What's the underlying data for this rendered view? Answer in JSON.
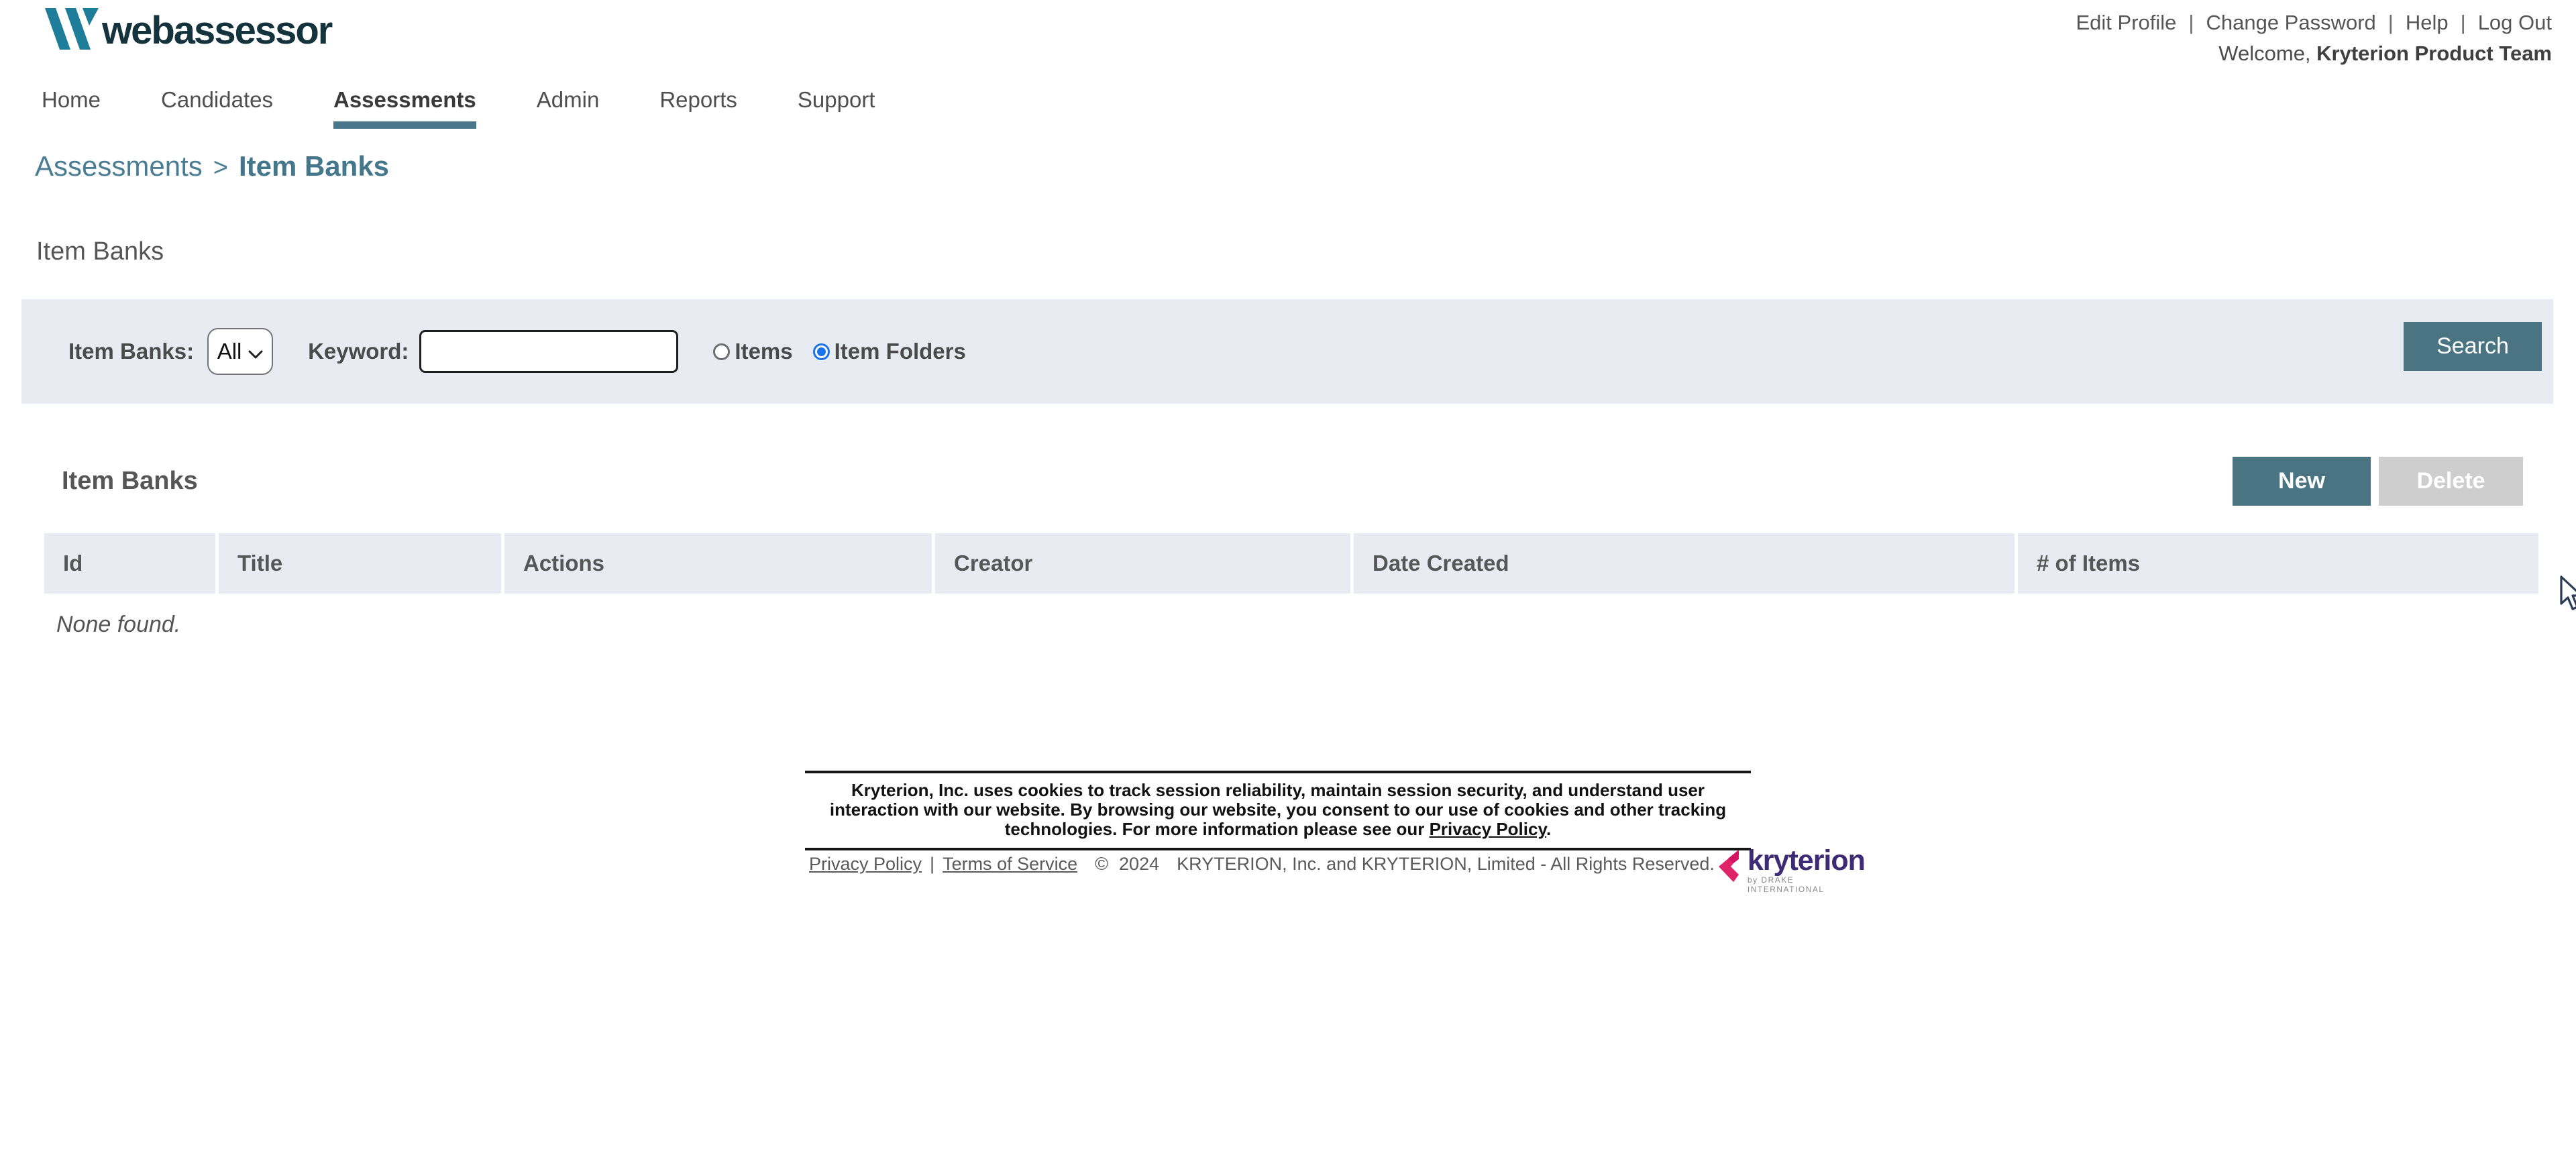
{
  "header": {
    "logo_text": "webassessor",
    "links": {
      "edit_profile": "Edit Profile",
      "change_password": "Change Password",
      "help": "Help",
      "log_out": "Log Out"
    },
    "separator": "|",
    "welcome_prefix": "Welcome,",
    "welcome_name": "Kryterion Product Team"
  },
  "nav": {
    "items": [
      {
        "label": "Home",
        "active": false
      },
      {
        "label": "Candidates",
        "active": false
      },
      {
        "label": "Assessments",
        "active": true
      },
      {
        "label": "Admin",
        "active": false
      },
      {
        "label": "Reports",
        "active": false
      },
      {
        "label": "Support",
        "active": false
      }
    ]
  },
  "breadcrumb": {
    "parent": "Assessments",
    "separator": ">",
    "current": "Item Banks"
  },
  "page": {
    "title": "Item Banks"
  },
  "search": {
    "item_banks_label": "Item Banks:",
    "item_banks_value": "All",
    "keyword_label": "Keyword:",
    "keyword_value": "",
    "radio_items_label": "Items",
    "radio_item_folders_label": "Item Folders",
    "selected_radio": "Item Folders",
    "search_button": "Search"
  },
  "list": {
    "title": "Item Banks",
    "new_button": "New",
    "delete_button": "Delete",
    "delete_enabled": false,
    "columns": [
      "Id",
      "Title",
      "Actions",
      "Creator",
      "Date Created",
      "# of Items"
    ],
    "rows": [],
    "empty_text": "None found."
  },
  "footer": {
    "cookie_text_before_link": "Kryterion, Inc. uses cookies to track session reliability, maintain session security, and understand user interaction with our website. By browsing our website, you consent to our use of cookies and other tracking technologies. For more information please see our ",
    "cookie_link": "Privacy Policy",
    "cookie_text_after_link": ".",
    "privacy_link": "Privacy Policy ",
    "terms_link": "Terms of Service ",
    "links_separator": "|",
    "copyright_symbol": "©",
    "copyright_year": "2024",
    "copyright_text": "KRYTERION, Inc. and KRYTERION, Limited - All Rights Reserved.",
    "logo_text": "kryterion",
    "logo_subtext": "by DRAKE INTERNATIONAL"
  },
  "colors": {
    "accent_teal": "#4a7482",
    "nav_underline": "#49768a",
    "breadcrumb": "#4a7d93",
    "logo_mark_teal": "#1e7d99",
    "logo_text_dark": "#14333c",
    "panel_bg": "#e8ebf1",
    "table_header_bg": "#e8ebf1",
    "disabled_button": "#cecece",
    "radio_selected_blue": "#1a73e8",
    "kryterion_pink": "#e0226b",
    "kryterion_purple": "#3e2a75"
  }
}
